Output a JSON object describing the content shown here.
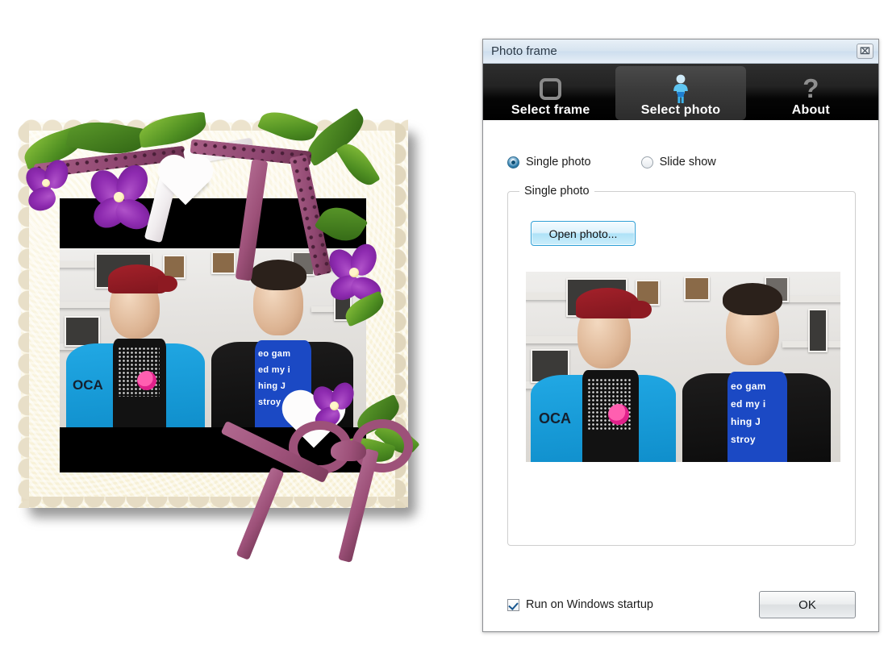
{
  "window": {
    "title": "Photo frame",
    "close_label": "⌧",
    "close_icon": "close-icon"
  },
  "tabs": [
    {
      "label": "Select frame",
      "icon": "rounded-square-icon",
      "selected": false
    },
    {
      "label": "Select photo",
      "icon": "person-icon",
      "selected": true
    },
    {
      "label": "About",
      "icon": "question-mark-icon",
      "selected": false
    }
  ],
  "mode": {
    "options": [
      {
        "label": "Single photo",
        "selected": true
      },
      {
        "label": "Slide show",
        "selected": false
      }
    ]
  },
  "group": {
    "title": "Single photo",
    "open_button": "Open photo..."
  },
  "startup": {
    "label": "Run on Windows startup",
    "checked": true
  },
  "ok_button": "OK",
  "colors": {
    "accent_blue": "#2e9fd6",
    "tab_bar": "#000000",
    "titlebar": "#d7e4f0",
    "radio_on": "#2f7fae",
    "check_on": "#18568f"
  },
  "photo": {
    "caption": "Two people standing in front of a white wall with framed pictures",
    "left_person": {
      "cap_color": "#8d1a22",
      "jacket_color": "#21a8e4",
      "shirt_color": "#121212",
      "logo_word": "OCA"
    },
    "right_person": {
      "jacket_color": "#1d1c1c",
      "shirt_color": "#1b49c4",
      "shirt_lines": [
        "eo gam",
        "ed my i",
        "hing J",
        "stroy"
      ]
    }
  },
  "frame_art": {
    "name": "decorative floral photo frame",
    "mat_color": "#e3d9c0",
    "flower_color": "#8e2bb0",
    "leaf_color": "#4f8f22",
    "ribbon_color": "#9d5179",
    "letterbox_color": "#000000"
  }
}
